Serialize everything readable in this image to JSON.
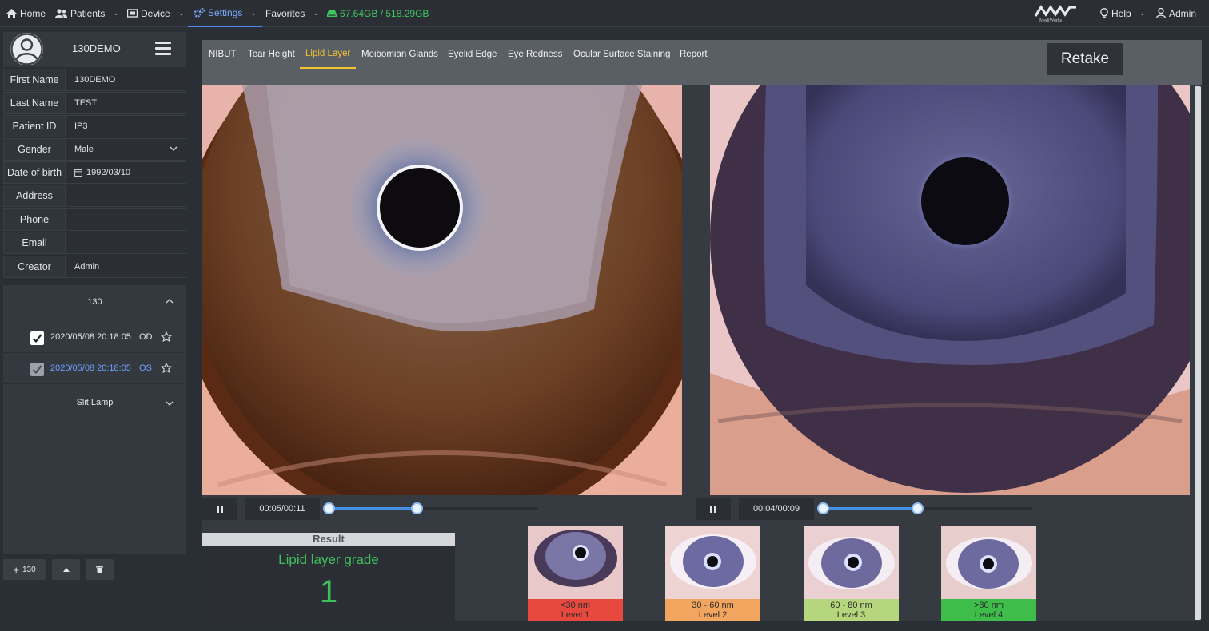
{
  "topbar": {
    "home": "Home",
    "patients": "Patients",
    "device": "Device",
    "settings": "Settings",
    "favorites": "Favorites",
    "storage": "67.64GB / 518.29GB",
    "logo_text": "MediWorks",
    "help": "Help",
    "admin": "Admin"
  },
  "patient": {
    "name": "130DEMO",
    "fields": [
      {
        "label": "First Name",
        "value": "130DEMO"
      },
      {
        "label": "Last Name",
        "value": "TEST"
      },
      {
        "label": "Patient ID",
        "value": "IP3"
      },
      {
        "label": "Gender",
        "value": "Male"
      },
      {
        "label": "Date of birth",
        "value": "1992/03/10"
      },
      {
        "label": "Address",
        "value": ""
      },
      {
        "label": "Phone",
        "value": ""
      },
      {
        "label": "Email",
        "value": ""
      },
      {
        "label": "Creator",
        "value": "Admin"
      }
    ]
  },
  "sessions": {
    "group": "130",
    "items": [
      {
        "date": "2020/05/08 20:18:05",
        "eye": "OD",
        "checked": true,
        "selected": false
      },
      {
        "date": "2020/05/08 20:18:05",
        "eye": "OS",
        "checked": true,
        "selected": true
      }
    ],
    "device_group": "Slit Lamp"
  },
  "left_buttons": {
    "add_label": "130"
  },
  "tabs": [
    "NIBUT",
    "Tear Height",
    "Lipid Layer",
    "Meibomian Glands",
    "Eyelid Edge",
    "Eye Redness",
    "Ocular Surface Staining",
    "Report"
  ],
  "active_tab": "Lipid Layer",
  "retake_label": "Retake",
  "players": [
    {
      "time": "00:05/00:11",
      "range_start": 0.0,
      "range_end": 0.42
    },
    {
      "time": "00:04/00:09",
      "range_start": 0.0,
      "range_end": 0.45
    }
  ],
  "result": {
    "header": "Result",
    "label": "Lipid layer grade",
    "value": "1"
  },
  "levels": [
    {
      "range": "<30 nm",
      "level": "Level 1",
      "color": "#e8493f"
    },
    {
      "range": "30 - 60 nm",
      "level": "Level 2",
      "color": "#f2a55e"
    },
    {
      "range": "60 - 80 nm",
      "level": "Level 3",
      "color": "#b5d67c"
    },
    {
      "range": ">80 nm",
      "level": "Level 4",
      "color": "#3ebd4a"
    }
  ],
  "colors": {
    "accent": "#4d8bf0",
    "active_tab": "#f2c230",
    "storage": "#3ec65f",
    "result": "#3fc05a"
  }
}
